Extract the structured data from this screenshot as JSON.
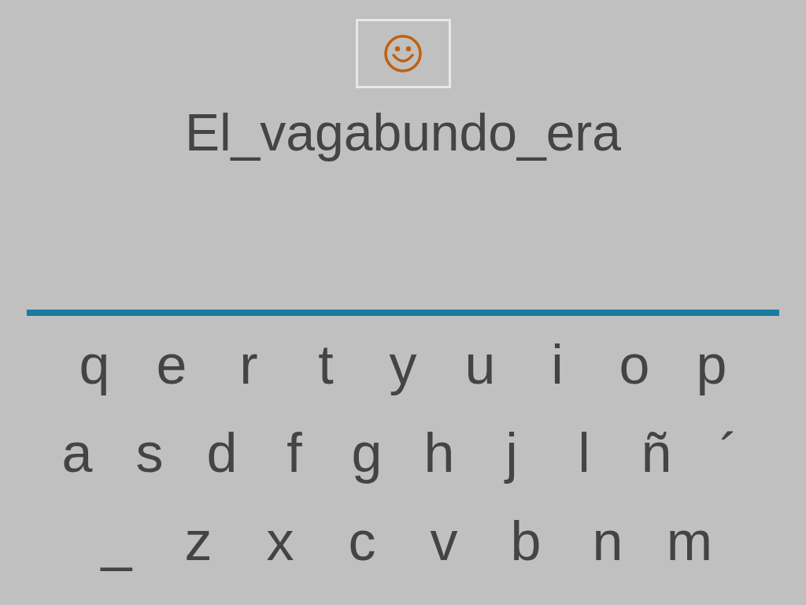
{
  "phrase": "El_vagabundo_era",
  "keyboard": {
    "rows": [
      [
        "q",
        "e",
        "r",
        "t",
        "y",
        "u",
        "i",
        "o",
        "p"
      ],
      [
        "a",
        "s",
        "d",
        "f",
        "g",
        "h",
        "j",
        "l",
        "ñ",
        "´"
      ],
      [
        "_",
        "z",
        "x",
        "c",
        "v",
        "b",
        "n",
        "m"
      ]
    ]
  }
}
